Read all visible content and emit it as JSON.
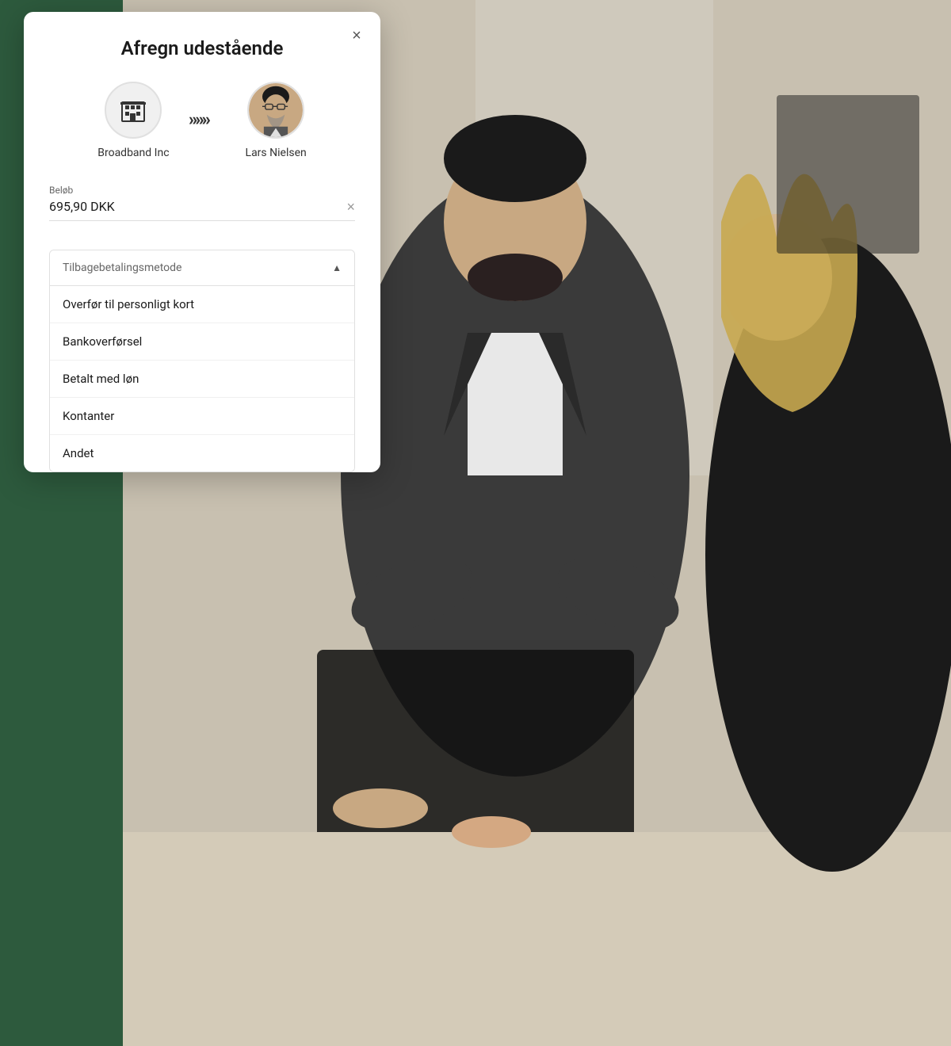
{
  "modal": {
    "title": "Afregn udestående",
    "close_label": "×",
    "from_entity": {
      "name": "Broadband Inc",
      "type": "company"
    },
    "to_entity": {
      "name": "Lars Nielsen",
      "type": "person"
    },
    "amount_label": "Beløb",
    "amount_value": "695,90 DKK",
    "dropdown": {
      "label": "Tilbagebetalingsmetode",
      "options": [
        "Overfør til personligt kort",
        "Bankoverførsel",
        "Betalt med løn",
        "Kontanter",
        "Andet"
      ]
    }
  }
}
